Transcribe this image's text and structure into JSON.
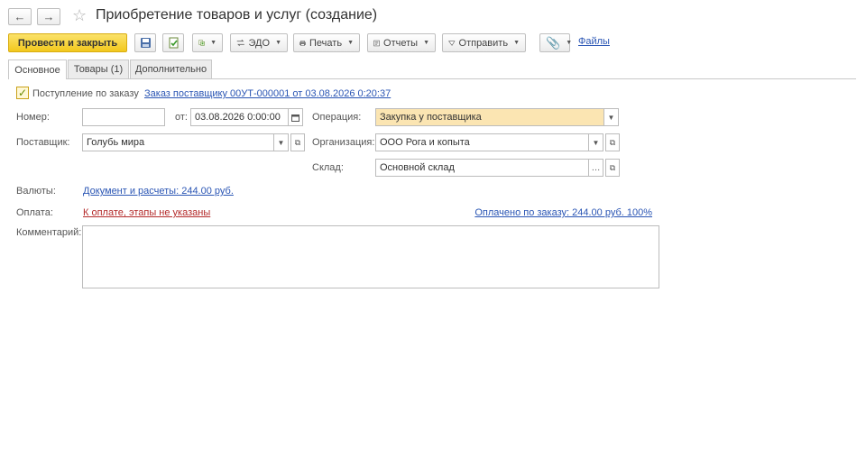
{
  "window": {
    "title": "Приобретение товаров и услуг (создание)",
    "back_icon": "←",
    "forward_icon": "→",
    "star_icon": "☆"
  },
  "toolbar": {
    "post_and_close": "Провести и закрыть",
    "edo": "ЭДО",
    "print": "Печать",
    "reports": "Отчеты",
    "send": "Отправить",
    "files": "Файлы"
  },
  "tabs": [
    {
      "label": "Основное"
    },
    {
      "label": "Товары (1)"
    },
    {
      "label": "Дополнительно"
    }
  ],
  "form": {
    "by_order_label": "Поступление по заказу",
    "by_order_checked": true,
    "order_link": "Заказ поставщику 00УТ-000001 от 03.08.2026 0:20:37",
    "number_label": "Номер:",
    "number_value": "",
    "from_label": "от:",
    "date_value": "03.08.2026  0:00:00",
    "operation_label": "Операция:",
    "operation_value": "Закупка у поставщика",
    "supplier_label": "Поставщик:",
    "supplier_value": "Голубь мира",
    "organization_label": "Организация:",
    "organization_value": "ООО Рога и копыта",
    "warehouse_label": "Склад:",
    "warehouse_value": "Основной склад",
    "currency_label": "Валюты:",
    "currency_link": "Документ и расчеты: 244.00 руб.",
    "payment_label": "Оплата:",
    "payment_link": "К оплате, этапы не указаны",
    "paid_link": "Оплачено по заказу: 244.00 руб. 100%",
    "comment_label": "Комментарий:",
    "comment_value": ""
  },
  "colors": {
    "primary_button": "#f2c81d",
    "link": "#2a55b4",
    "warning_link": "#b42a2a",
    "highlight_field": "#fbe5b2"
  }
}
